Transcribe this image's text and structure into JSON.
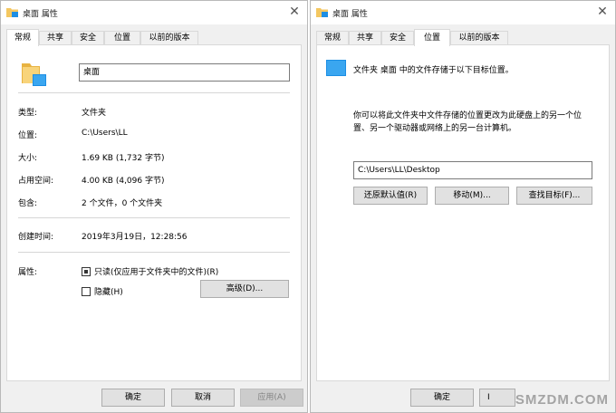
{
  "left_dialog": {
    "title": "桌面 属性",
    "close_glyph": "✕",
    "tabs": [
      "常规",
      "共享",
      "安全",
      "位置",
      "以前的版本"
    ],
    "active_tab": "常规",
    "name_value": "桌面",
    "rows": [
      {
        "label": "类型:",
        "value": "文件夹"
      },
      {
        "label": "位置:",
        "value": "C:\\Users\\LL"
      },
      {
        "label": "大小:",
        "value": "1.69 KB (1,732 字节)"
      },
      {
        "label": "占用空间:",
        "value": "4.00 KB (4,096 字节)"
      },
      {
        "label": "包含:",
        "value": "2 个文件，0 个文件夹"
      }
    ],
    "created_label": "创建时间:",
    "created_value": "2019年3月19日，12:28:56",
    "attributes_label": "属性:",
    "readonly_label": "只读(仅应用于文件夹中的文件)(R)",
    "readonly_checked": true,
    "hidden_label": "隐藏(H)",
    "hidden_checked": false,
    "advanced_button": "高级(D)...",
    "ok_button": "确定",
    "cancel_button": "取消",
    "apply_button": "应用(A)"
  },
  "right_dialog": {
    "title": "桌面 属性",
    "close_glyph": "✕",
    "tabs": [
      "常规",
      "共享",
      "安全",
      "位置",
      "以前的版本"
    ],
    "active_tab": "位置",
    "intro": "文件夹 桌面 中的文件存储于以下目标位置。",
    "description_line1": "你可以将此文件夹中文件存储的位置更改为此硬盘上的另一个位",
    "description_line2": "置、另一个驱动器或网络上的另一台计算机。",
    "path_value": "C:\\Users\\LL\\Desktop",
    "restore_button": "还原默认值(R)",
    "move_button": "移动(M)...",
    "find_target_button": "查找目标(F)...",
    "ok_button": "确定",
    "partial_button_text": "I"
  },
  "watermark": "SMZDM.COM",
  "colors": {
    "folder_yellow": "#f4c760",
    "desktop_blue": "#1c8ee4",
    "dialog_bg": "#f0f0f0",
    "panel_bg": "#ffffff"
  }
}
